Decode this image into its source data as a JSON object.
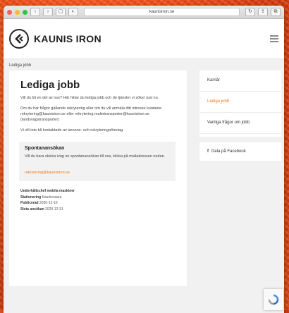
{
  "browser": {
    "address": "kaunisiron.se"
  },
  "header": {
    "brand": "KAUNIS IRON"
  },
  "breadcrumb": "Lediga jobb",
  "main": {
    "title": "Lediga jobb",
    "intro": "Vill du bli en del av oss? Här hittar du lediga jobb och de tjänster vi söker just nu.",
    "contact_p1": "Om du har frågor gällande rekrytering eller om du vill anmäla ditt intresse kontakta",
    "contact_emails": "rekrytering@kaunisiron.se eller rekrytering.malmtransporter@kaunisiron.se (landsvägstransporter)",
    "notice": "Vi vill inte bli kontaktade av annons- och rekryteringsföretag.",
    "spontan": {
      "title": "Spontanansökan",
      "text": "Vill du bara skicka iväg en spontanansökan till oss, klicka på mailadressen nedan.",
      "email": "rekrytering@kaunisiron.se"
    },
    "meta": {
      "maintainer_label": "Underhållschef mobila maskiner",
      "location_label": "Stationering",
      "location_value": "Kaunisvaara",
      "published_label": "Publicerad",
      "published_value": "2020-12-10",
      "lastdate_label": "Sista ansökan",
      "lastdate_value": "2020-12-31"
    }
  },
  "sidebar": {
    "items": [
      {
        "label": "Karriär"
      },
      {
        "label": "Lediga jobb"
      },
      {
        "label": "Vanliga frågor om jobb"
      }
    ],
    "share": "Dela på Facebook"
  },
  "colors": {
    "accent": "#e9791d",
    "background": "#e8501c"
  }
}
